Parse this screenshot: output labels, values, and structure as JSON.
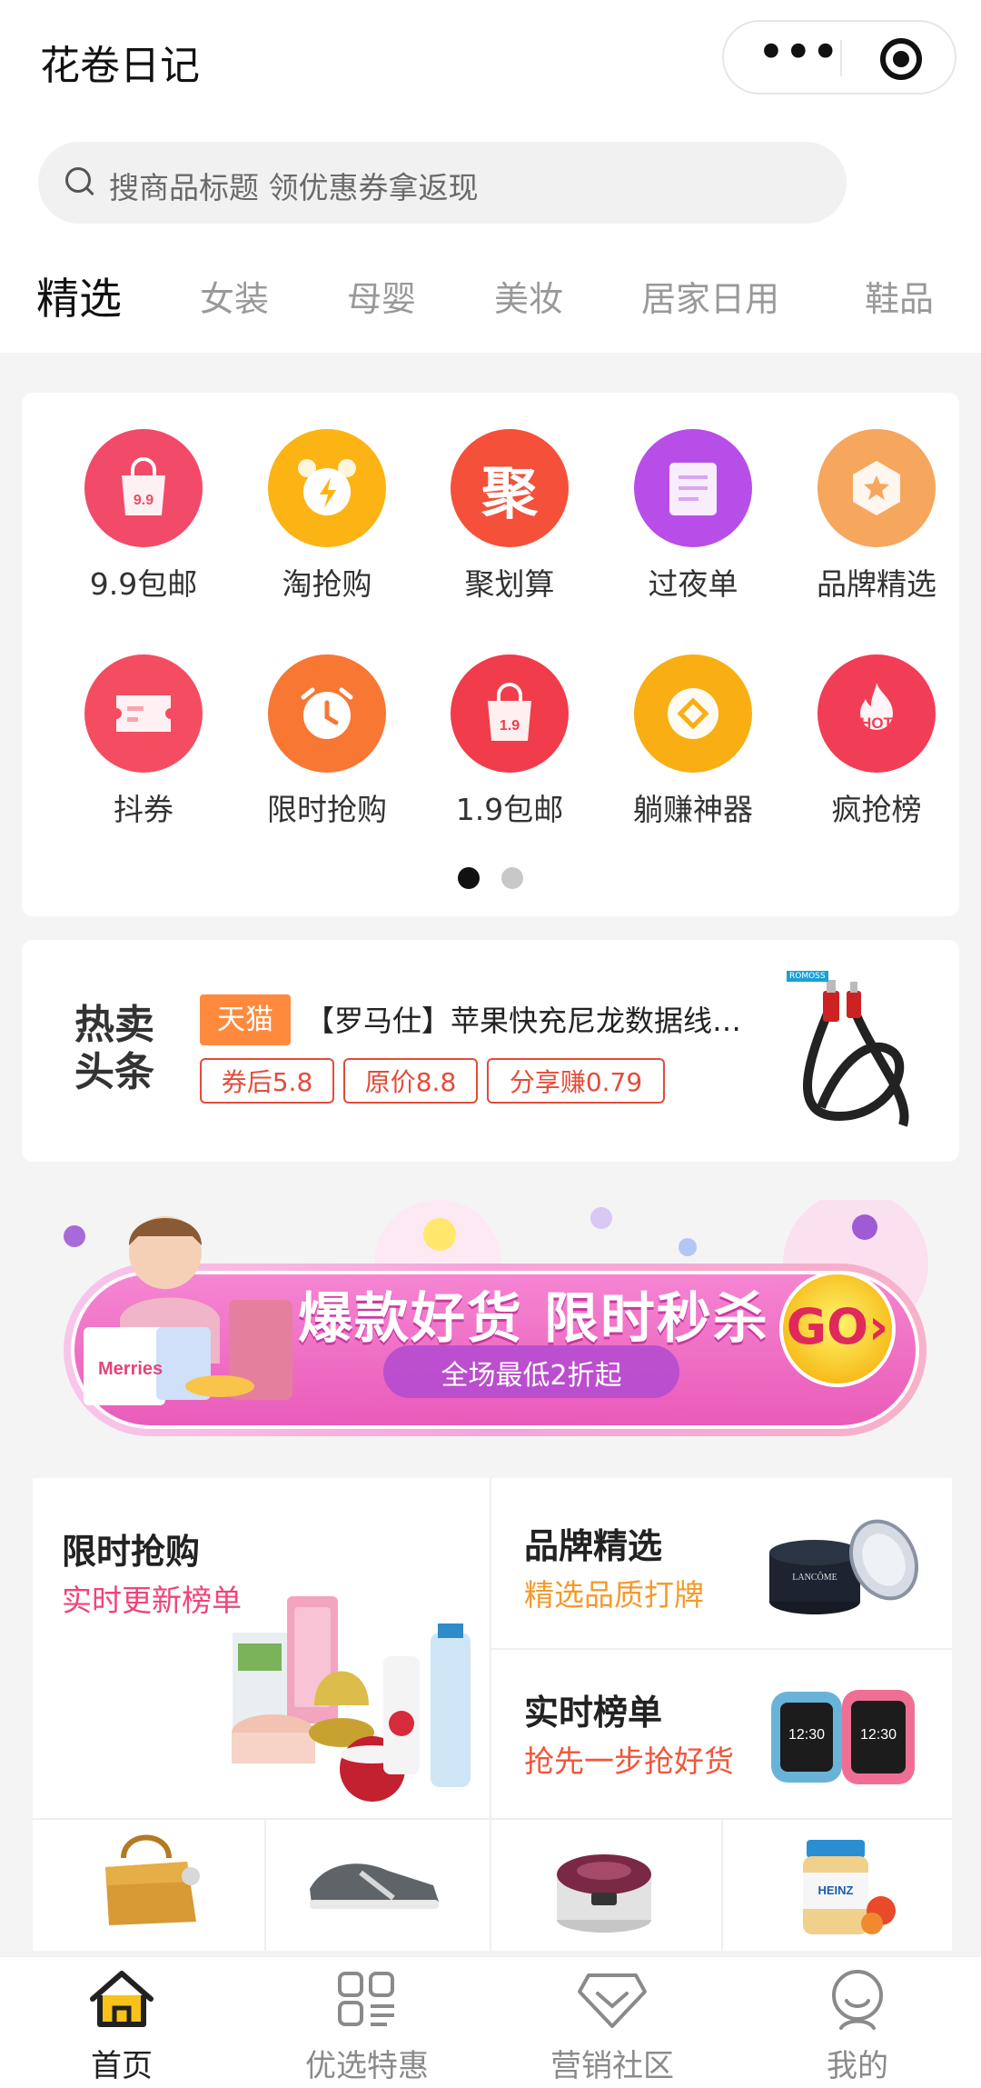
{
  "app": {
    "title": "花卷日记"
  },
  "capsule": {
    "more_icon": "more-dots-icon",
    "close_icon": "record-target-icon"
  },
  "search": {
    "placeholder": "搜商品标题 领优惠券拿返现"
  },
  "tabs": [
    {
      "label": "精选",
      "active": true
    },
    {
      "label": "女装"
    },
    {
      "label": "母婴"
    },
    {
      "label": "美妆"
    },
    {
      "label": "居家日用"
    },
    {
      "label": "鞋品"
    }
  ],
  "grid": {
    "items": [
      {
        "label": "9.9包邮",
        "icon": "bag-9.9-icon",
        "icon_text": "9.9",
        "color": "#f24a69"
      },
      {
        "label": "淘抢购",
        "icon": "alarm-bolt-icon",
        "color": "#fcb414"
      },
      {
        "label": "聚划算",
        "icon": "ju-icon",
        "icon_text": "聚",
        "color": "#f4503a"
      },
      {
        "label": "过夜单",
        "icon": "document-icon",
        "color": "#b84ee8"
      },
      {
        "label": "品牌精选",
        "icon": "brand-star-icon",
        "color": "#f6a65d"
      },
      {
        "label": "抖券",
        "icon": "ticket-icon",
        "color": "#f44d62"
      },
      {
        "label": "限时抢购",
        "icon": "clock-icon",
        "color": "#f77733"
      },
      {
        "label": "1.9包邮",
        "icon": "bag-1.9-icon",
        "icon_text": "1.9",
        "color": "#f03c4b"
      },
      {
        "label": "躺赚神器",
        "icon": "coin-icon",
        "color": "#f9ae13"
      },
      {
        "label": "疯抢榜",
        "icon": "hot-flame-icon",
        "icon_text": "HOT",
        "color": "#f23d56"
      }
    ],
    "pages": 2,
    "current_page": 1
  },
  "news": {
    "logo_line1": "热卖",
    "logo_line2": "头条",
    "platform": "天猫",
    "title": "【罗马仕】苹果快充尼龙数据线…",
    "tags": [
      "券后5.8",
      "原价8.8",
      "分享赚0.79"
    ],
    "product_image": "usb-cable-image",
    "brand_mini": "ROMOSS"
  },
  "banner": {
    "headline": "爆款好货 限时秒杀",
    "sub": "全场最低2折起",
    "go": "GO›",
    "product_mark": "Merries"
  },
  "features": [
    {
      "title": "限时抢购",
      "sub": "实时更新榜单",
      "color": "#f0447a",
      "image": "cosmetics-image"
    },
    {
      "title": "品牌精选",
      "sub": "精选品质打牌",
      "color": "#f59a2c",
      "image": "face-cream-image",
      "image_brand": "LANCÔME"
    },
    {
      "title": "实时榜单",
      "sub": "抢先一步抢好货",
      "color": "#f2553a",
      "image": "smartwatch-image",
      "image_time": "12:30"
    }
  ],
  "products": [
    {
      "image": "handbag-image"
    },
    {
      "image": "sneaker-image"
    },
    {
      "image": "rice-cooker-image"
    },
    {
      "image": "baby-food-jar-image",
      "image_brand": "HEINZ"
    }
  ],
  "tabbar": [
    {
      "label": "首页",
      "icon": "home-icon",
      "active": true
    },
    {
      "label": "优选特惠",
      "icon": "grid-list-icon"
    },
    {
      "label": "营销社区",
      "icon": "diamond-icon"
    },
    {
      "label": "我的",
      "icon": "profile-icon"
    }
  ]
}
